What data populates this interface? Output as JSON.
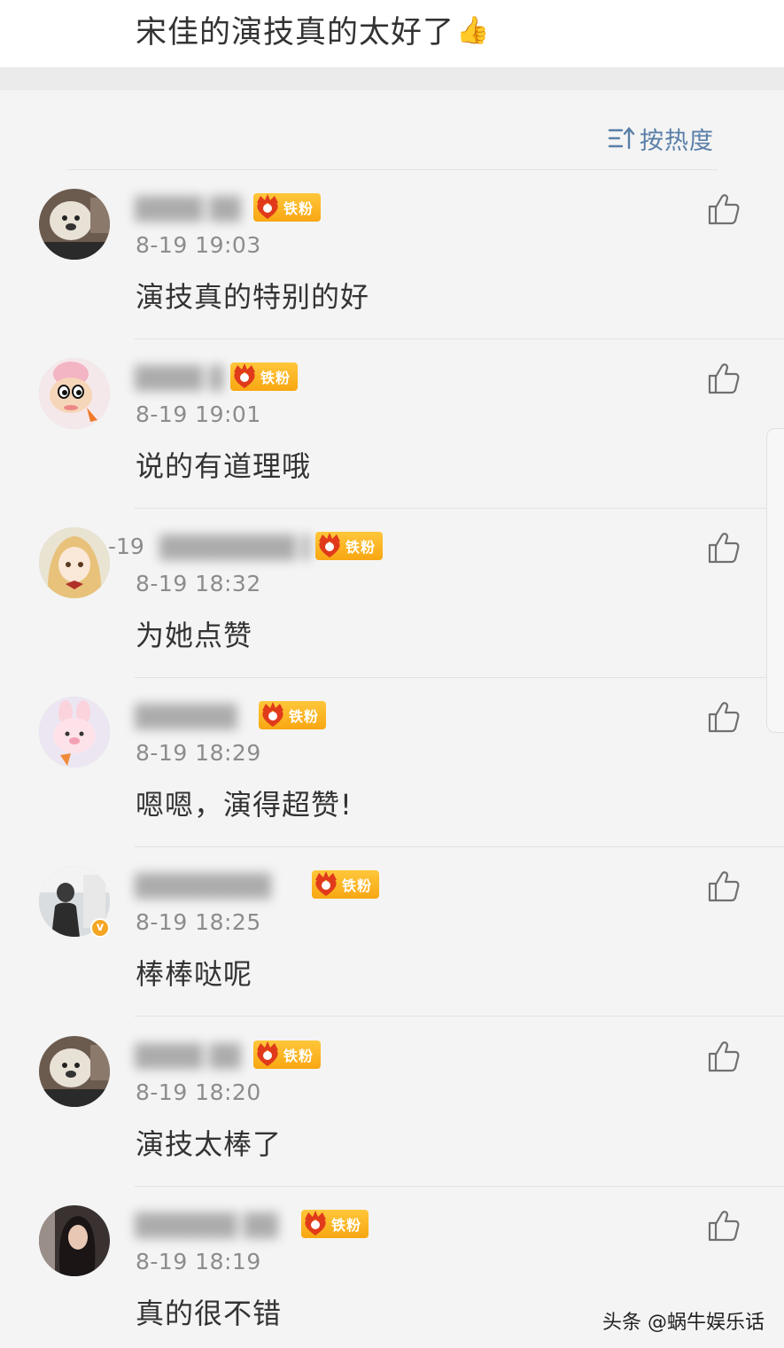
{
  "post": {
    "text": "宋佳的演技真的太好了",
    "emoji": "👍"
  },
  "sort": {
    "label": "按热度"
  },
  "comments": [
    {
      "username": "████ ██",
      "badge": "铁粉",
      "time": "8-19 19:03",
      "text": "演技真的特别的好"
    },
    {
      "username": "████ ██",
      "badge": "铁粉",
      "time": "8-19 19:01",
      "text": "说的有道理哦"
    },
    {
      "username": "████████ ██",
      "stray": "-19",
      "badge": "铁粉",
      "time": "8-19 18:32",
      "text": "为她点赞"
    },
    {
      "username": "██████",
      "badge": "铁粉",
      "time": "8-19 18:29",
      "text": "嗯嗯，演得超赞!"
    },
    {
      "username": "████████",
      "badge": "铁粉",
      "time": "8-19 18:25",
      "text": "棒棒哒呢",
      "verified": "v"
    },
    {
      "username": "████ ██",
      "badge": "铁粉",
      "time": "8-19 18:20",
      "text": "演技太棒了"
    },
    {
      "username": "██████ ██",
      "badge": "铁粉",
      "time": "8-19 18:19",
      "text": "真的很不错"
    }
  ],
  "watermark": "头条 @蜗牛娱乐话"
}
